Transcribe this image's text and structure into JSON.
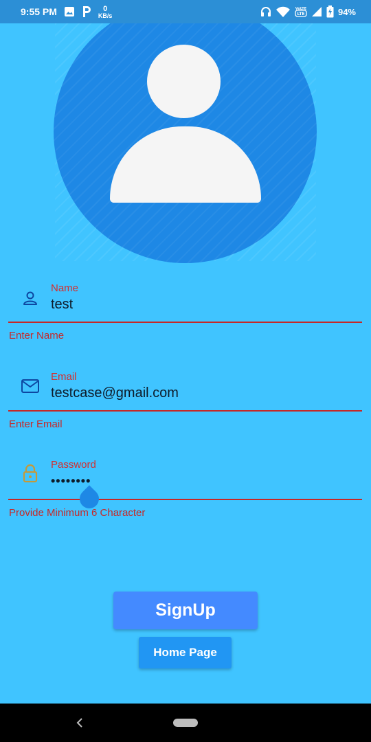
{
  "status_bar": {
    "time": "9:55 PM",
    "data_rate_value": "0",
    "data_rate_unit": "KB/s",
    "battery_percent": "94%",
    "icons": [
      "image-icon",
      "parking-icon",
      "headset-icon",
      "wifi-icon",
      "volte-icon",
      "signal-icon",
      "battery-icon"
    ]
  },
  "avatar": {
    "icon": "person-icon",
    "color": "#1E88E5"
  },
  "form": {
    "name": {
      "label": "Name",
      "value": "test",
      "error": "Enter Name",
      "icon": "person-outline-icon"
    },
    "email": {
      "label": "Email",
      "value": "testcase@gmail.com",
      "error": "Enter Email",
      "icon": "mail-icon"
    },
    "password": {
      "label": "Password",
      "value": "••••••••",
      "error": "Provide Minimum 6 Character",
      "icon": "lock-icon"
    }
  },
  "buttons": {
    "signup": "SignUp",
    "home": "Home Page"
  },
  "colors": {
    "background": "#40C4FF",
    "status_bar": "#2C8FD6",
    "error": "#C62828",
    "signup_button": "#448AFF",
    "home_button": "#2196F3"
  },
  "nav": {
    "icons": [
      "back-icon",
      "home-pill-icon"
    ]
  }
}
